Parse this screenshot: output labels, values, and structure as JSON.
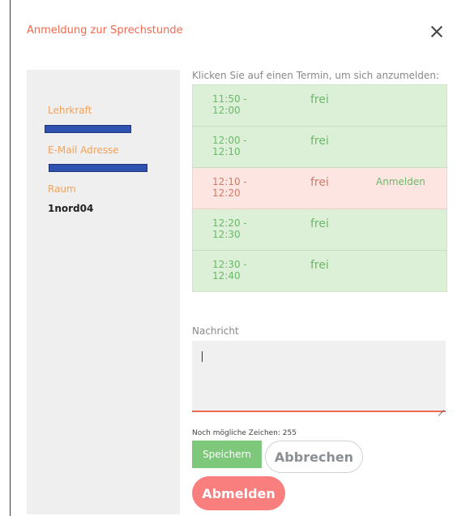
{
  "dialog": {
    "title": "Anmeldung zur Sprechstunde"
  },
  "info": {
    "teacher_label": "Lehrkraft",
    "email_label": "E-Mail Adresse",
    "room_label": "Raum",
    "room_value": "1nord04"
  },
  "slots": {
    "title": "Klicken Sie auf einen Termin, um sich anzumelden:",
    "items": [
      {
        "time": "11:50 - 12:00",
        "status": "frei",
        "action": ""
      },
      {
        "time": "12:00 - 12:10",
        "status": "frei",
        "action": ""
      },
      {
        "time": "12:10 - 12:20",
        "status": "frei",
        "action": "Anmelden"
      },
      {
        "time": "12:20 - 12:30",
        "status": "frei",
        "action": ""
      },
      {
        "time": "12:30 - 12:40",
        "status": "frei",
        "action": ""
      }
    ]
  },
  "message": {
    "label": "Nachricht",
    "value": "",
    "remaining": "Noch mögliche Zeichen: 255"
  },
  "buttons": {
    "save": "Speichern",
    "cancel": "Abbrechen",
    "logout": "Abmelden"
  },
  "colors": {
    "accent": "#f06a4f",
    "free_slot": "#dcefd7",
    "hover_slot": "#fde6e2",
    "save": "#7ec87b",
    "logout": "#f97f7f",
    "redaction": "#2f52b0"
  }
}
